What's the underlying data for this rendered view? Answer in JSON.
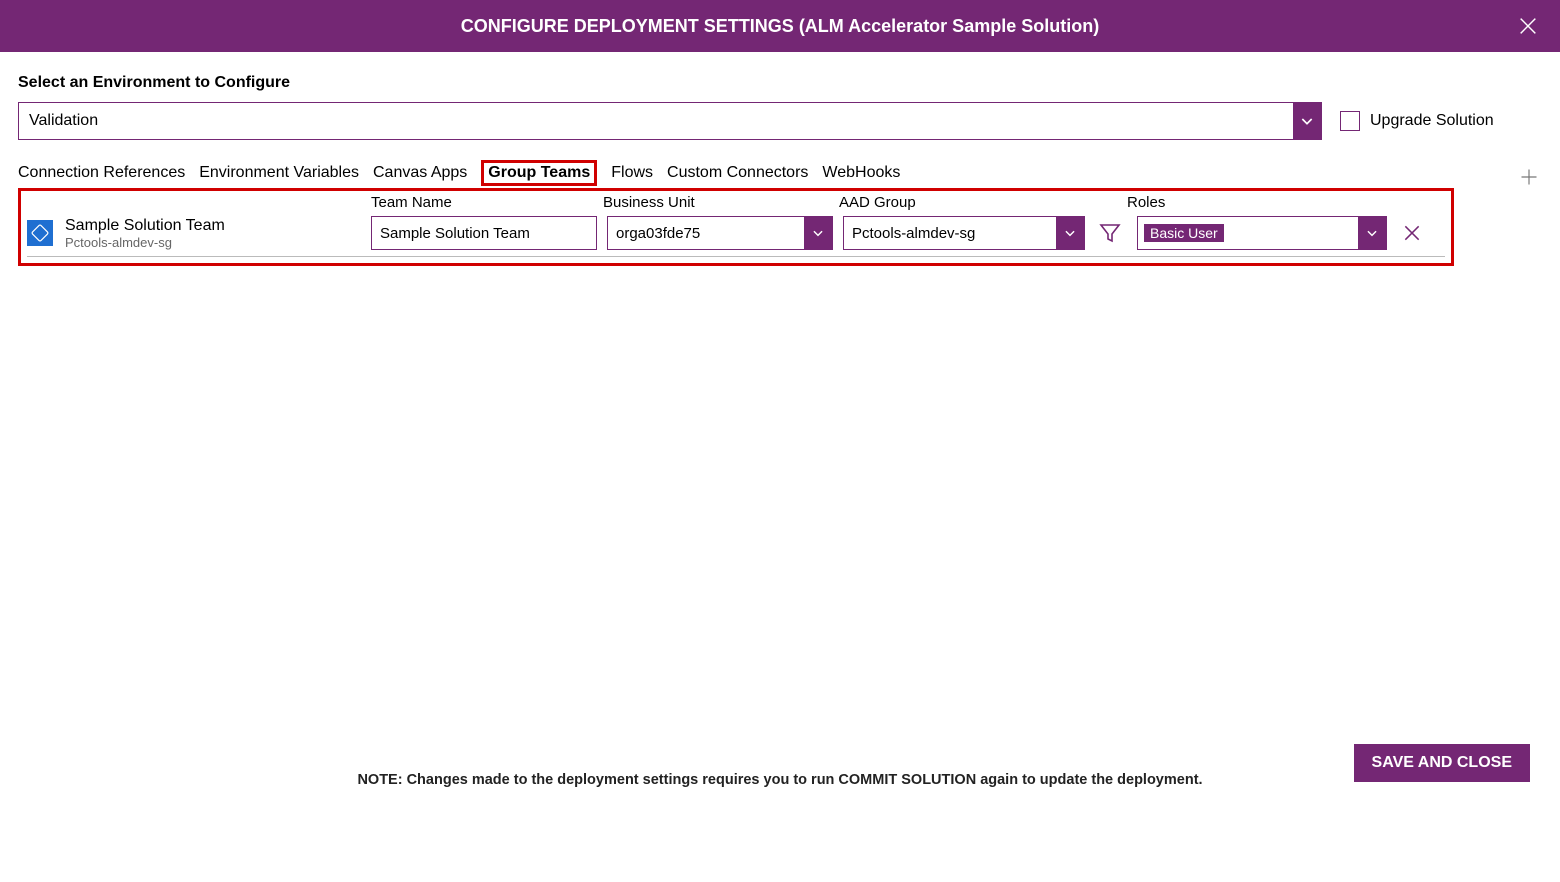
{
  "header": {
    "title": "CONFIGURE DEPLOYMENT SETTINGS (ALM Accelerator Sample Solution)"
  },
  "env": {
    "label": "Select an Environment to Configure",
    "value": "Validation"
  },
  "upgrade": {
    "label": "Upgrade Solution",
    "checked": false
  },
  "tabs": [
    "Connection References",
    "Environment Variables",
    "Canvas Apps",
    "Group Teams",
    "Flows",
    "Custom Connectors",
    "WebHooks"
  ],
  "active_tab_index": 3,
  "columns": {
    "team_name": "Team Name",
    "business_unit": "Business Unit",
    "aad_group": "AAD Group",
    "roles": "Roles"
  },
  "rows": [
    {
      "display_name": "Sample Solution Team",
      "display_sub": "Pctools-almdev-sg",
      "team_name": "Sample Solution Team",
      "business_unit": "orga03fde75",
      "aad_group": "Pctools-almdev-sg",
      "roles": "Basic User"
    }
  ],
  "footer": {
    "note": "NOTE: Changes made to the deployment settings requires you to run COMMIT SOLUTION again to update the deployment.",
    "save_label": "SAVE AND CLOSE"
  },
  "colors": {
    "brand": "#742774",
    "highlight": "#d00000"
  }
}
